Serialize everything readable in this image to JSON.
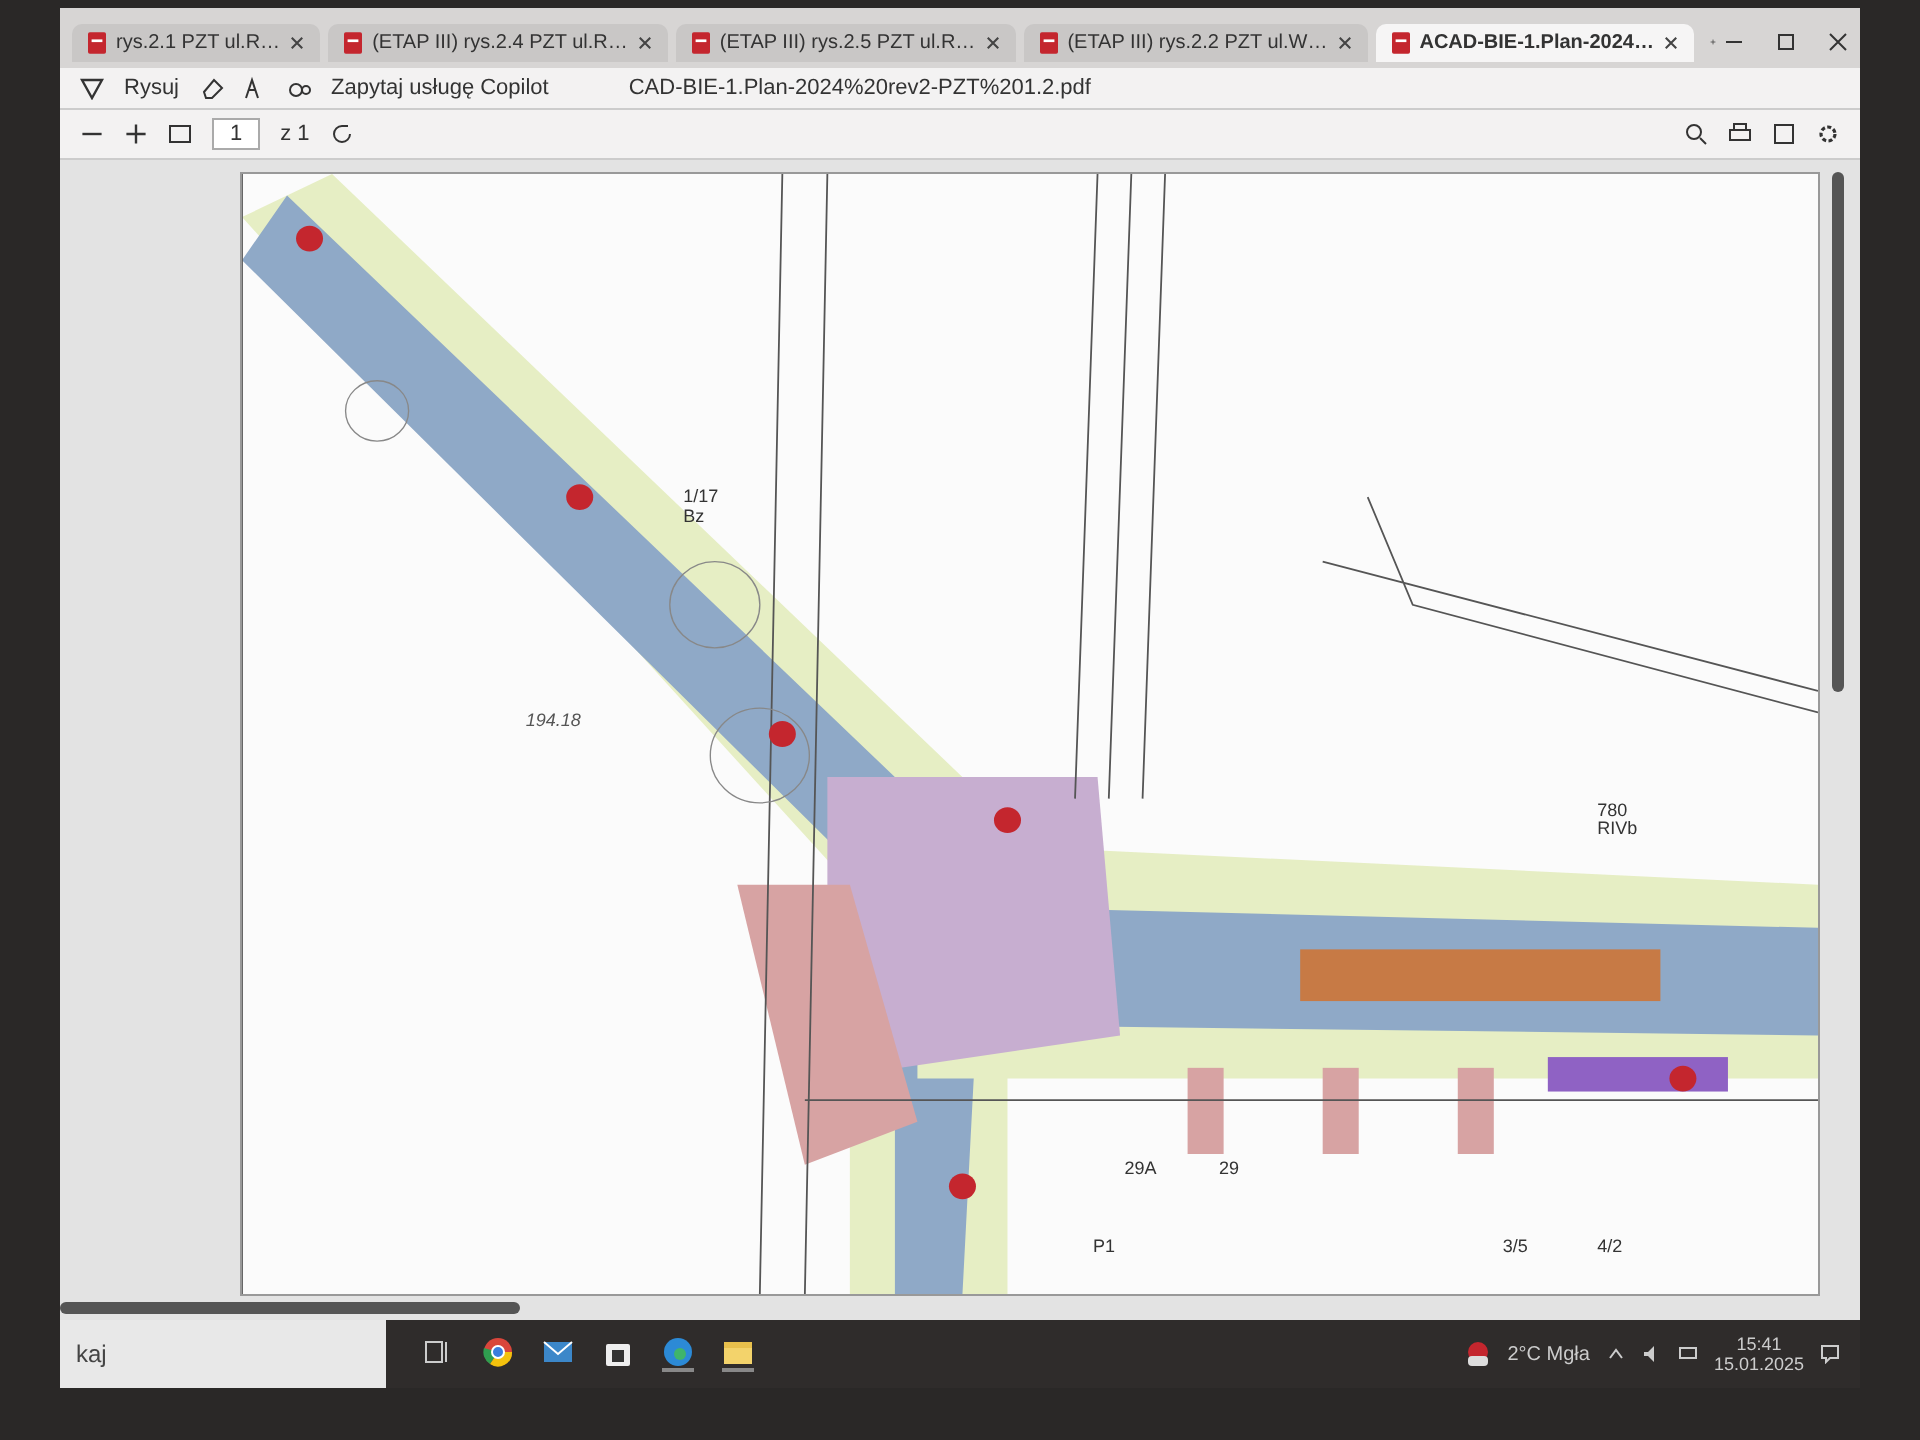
{
  "browser": {
    "tabs": [
      {
        "title": "rys.2.1 PZT ul.R…",
        "selected": false
      },
      {
        "title": "(ETAP III) rys.2.4 PZT ul.R…",
        "selected": false
      },
      {
        "title": "(ETAP III) rys.2.5 PZT ul.R…",
        "selected": false
      },
      {
        "title": "(ETAP III) rys.2.2 PZT ul.W…",
        "selected": false
      },
      {
        "title": "ACAD-BIE-1.Plan-2024…",
        "selected": true
      }
    ]
  },
  "pdf_toolbar": {
    "draw_label": "Rysuj",
    "copilot_label": "Zapytaj usługę Copilot",
    "file_name": "CAD-BIE-1.Plan-2024%20rev2-PZT%201.2.pdf",
    "page": "1",
    "page_count": "z 1"
  },
  "plan": {
    "labels": [
      {
        "text": "1/17\nBz",
        "kind": "parcel"
      },
      {
        "text": "194.18",
        "kind": "height"
      },
      {
        "text": "780\nRIVb",
        "kind": "parcel"
      },
      {
        "text": "29A",
        "kind": "parcel"
      },
      {
        "text": "29",
        "kind": "parcel"
      },
      {
        "text": "P1",
        "kind": "parcel"
      },
      {
        "text": "3/5",
        "kind": "parcel"
      },
      {
        "text": "4/2",
        "kind": "parcel"
      }
    ]
  },
  "taskbar": {
    "search_placeholder": "kaj",
    "weather": "2°C Mgła",
    "time": "15:41",
    "date": "15.01.2025"
  }
}
